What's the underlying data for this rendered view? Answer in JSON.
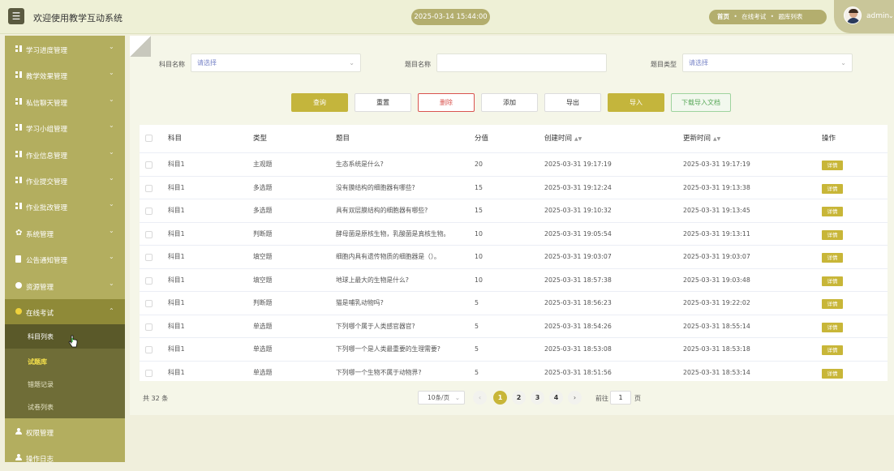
{
  "header": {
    "menu_icon": "hamburger-icon",
    "title": "欢迎使用教学互动系统",
    "datetime": "2025-03-14 15:44:00",
    "breadcrumbs": [
      "首页",
      "在线考试",
      "题库列表"
    ],
    "username": "admin"
  },
  "sidebar": {
    "items": [
      {
        "label": "学习进度管理",
        "icon": "grid-icon"
      },
      {
        "label": "教学效果管理",
        "icon": "grid-icon"
      },
      {
        "label": "私信聊天管理",
        "icon": "grid-icon"
      },
      {
        "label": "学习小组管理",
        "icon": "grid-icon"
      },
      {
        "label": "作业信息管理",
        "icon": "grid-icon"
      },
      {
        "label": "作业提交管理",
        "icon": "grid-icon"
      },
      {
        "label": "作业批改管理",
        "icon": "grid-icon"
      },
      {
        "label": "系统管理",
        "icon": "gear-icon"
      },
      {
        "label": "公告通知管理",
        "icon": "document-icon"
      },
      {
        "label": "资源管理",
        "icon": "plus-circle-icon"
      }
    ],
    "open_group": {
      "label": "在线考试",
      "icon": "plus-circle-icon",
      "children": [
        "科目列表",
        "试题库",
        "错题记录",
        "试卷列表"
      ]
    },
    "bottom_items": [
      {
        "label": "权限管理",
        "icon": "user-icon"
      },
      {
        "label": "操作日志",
        "icon": "user-icon"
      }
    ]
  },
  "filters": {
    "subject_label": "科目名称",
    "subject_placeholder": "请选择",
    "question_label": "题目名称",
    "question_value": "",
    "type_label": "题目类型",
    "type_placeholder": "请选择"
  },
  "actions": {
    "query": "查询",
    "reset": "重置",
    "delete": "删除",
    "add": "添加",
    "export": "导出",
    "import": "导入",
    "download_template": "下载导入文档"
  },
  "table": {
    "headers": [
      "科目",
      "类型",
      "题目",
      "分值",
      "创建时间",
      "更新时间",
      "操作"
    ],
    "detail_label": "详情",
    "rows": [
      {
        "subject": "科目1",
        "type": "主观题",
        "question": "生态系统是什么?",
        "score": "20",
        "created": "2025-03-31 19:17:19",
        "updated": "2025-03-31 19:17:19"
      },
      {
        "subject": "科目1",
        "type": "多选题",
        "question": "没有膜结构的细胞器有哪些?",
        "score": "15",
        "created": "2025-03-31 19:12:24",
        "updated": "2025-03-31 19:13:38"
      },
      {
        "subject": "科目1",
        "type": "多选题",
        "question": "具有双层膜结构的细胞器有哪些?",
        "score": "15",
        "created": "2025-03-31 19:10:32",
        "updated": "2025-03-31 19:13:45"
      },
      {
        "subject": "科目1",
        "type": "判断题",
        "question": "酵母菌是原核生物，乳酸菌是真核生物。",
        "score": "10",
        "created": "2025-03-31 19:05:54",
        "updated": "2025-03-31 19:13:11"
      },
      {
        "subject": "科目1",
        "type": "填空题",
        "question": "细胞内具有遗传物质的细胞器是（）。",
        "score": "10",
        "created": "2025-03-31 19:03:07",
        "updated": "2025-03-31 19:03:07"
      },
      {
        "subject": "科目1",
        "type": "填空题",
        "question": "地球上最大的生物是什么?",
        "score": "10",
        "created": "2025-03-31 18:57:38",
        "updated": "2025-03-31 19:03:48"
      },
      {
        "subject": "科目1",
        "type": "判断题",
        "question": "猫是哺乳动物吗?",
        "score": "5",
        "created": "2025-03-31 18:56:23",
        "updated": "2025-03-31 19:22:02"
      },
      {
        "subject": "科目1",
        "type": "单选题",
        "question": "下列哪个属于人类感官器官?",
        "score": "5",
        "created": "2025-03-31 18:54:26",
        "updated": "2025-03-31 18:55:14"
      },
      {
        "subject": "科目1",
        "type": "单选题",
        "question": "下列哪一个是人类最重要的生理需要?",
        "score": "5",
        "created": "2025-03-31 18:53:08",
        "updated": "2025-03-31 18:53:18"
      },
      {
        "subject": "科目1",
        "type": "单选题",
        "question": "下列哪一个生物不属于动物界?",
        "score": "5",
        "created": "2025-03-31 18:51:56",
        "updated": "2025-03-31 18:53:14"
      }
    ]
  },
  "pagination": {
    "total": "共 32 条",
    "page_size": "10条/页",
    "pages": [
      "1",
      "2",
      "3",
      "4"
    ],
    "current": "1",
    "goto_label": "前往",
    "goto_value": "1",
    "goto_unit": "页"
  }
}
